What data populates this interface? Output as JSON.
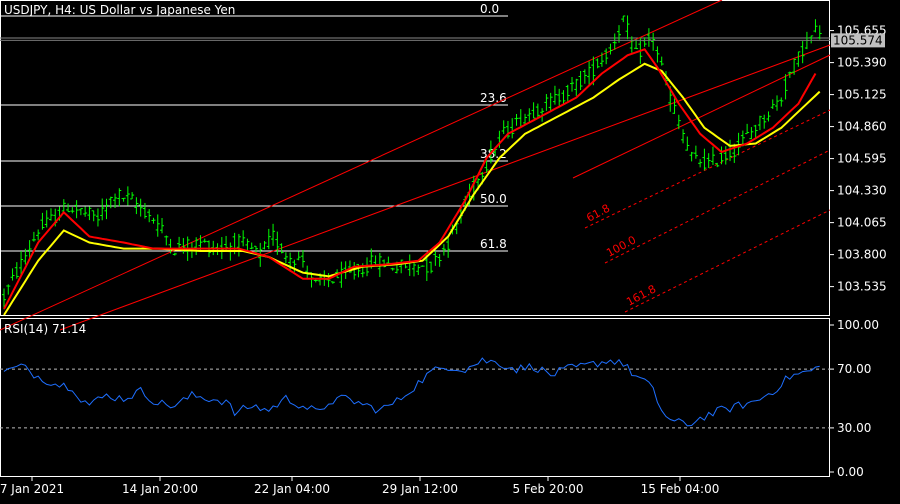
{
  "title": "USDJPY, H4:  US Dollar vs Japanese Yen",
  "colors": {
    "background": "#000000",
    "frame": "#ffffff",
    "bull_candle": "#00ff00",
    "ma_fast": "#ff0000",
    "ma_slow": "#ffff00",
    "fib_line": "#ffffff",
    "channel": "#ff0000",
    "fib_expansion": "#ff0000",
    "rsi_line": "#1e6fff",
    "price_label_bg": "#c0c0c0",
    "price_label_text": "#000000"
  },
  "chart_data": {
    "type": "candlestick",
    "symbol": "USDJPY",
    "timeframe": "H4",
    "price_axis": {
      "min": 103.3,
      "max": 105.9,
      "ticks": [
        "105.655",
        "105.390",
        "105.125",
        "104.860",
        "104.595",
        "104.330",
        "104.065",
        "103.800",
        "103.535"
      ]
    },
    "current_price": "105.574",
    "x_ticks": [
      "7 Jan 2021",
      "14 Jan 20:00",
      "22 Jan 04:00",
      "29 Jan 12:00",
      "5 Feb 20:00",
      "15 Feb 04:00"
    ],
    "close_path": [
      [
        0,
        103.45
      ],
      [
        8,
        104.0
      ],
      [
        15,
        104.2
      ],
      [
        22,
        104.1
      ],
      [
        26,
        104.3
      ],
      [
        30,
        104.25
      ],
      [
        35,
        104.1
      ],
      [
        40,
        103.85
      ],
      [
        46,
        103.9
      ],
      [
        50,
        103.85
      ],
      [
        55,
        103.9
      ],
      [
        60,
        103.8
      ],
      [
        63,
        103.95
      ],
      [
        66,
        103.8
      ],
      [
        70,
        103.75
      ],
      [
        73,
        103.55
      ],
      [
        77,
        103.6
      ],
      [
        82,
        103.65
      ],
      [
        87,
        103.75
      ],
      [
        92,
        103.7
      ],
      [
        97,
        103.72
      ],
      [
        100,
        103.7
      ],
      [
        104,
        103.9
      ],
      [
        108,
        104.2
      ],
      [
        112,
        104.5
      ],
      [
        117,
        104.8
      ],
      [
        122,
        104.95
      ],
      [
        127,
        105.05
      ],
      [
        132,
        105.15
      ],
      [
        137,
        105.3
      ],
      [
        142,
        105.5
      ],
      [
        145,
        105.75
      ],
      [
        148,
        105.45
      ],
      [
        152,
        105.6
      ],
      [
        156,
        105.1
      ],
      [
        159,
        104.8
      ],
      [
        161,
        104.6
      ],
      [
        165,
        104.55
      ],
      [
        169,
        104.62
      ],
      [
        172,
        104.7
      ],
      [
        177,
        104.9
      ],
      [
        182,
        105.1
      ],
      [
        184,
        105.3
      ],
      [
        187,
        105.5
      ],
      [
        190,
        105.65
      ]
    ],
    "ma_fast_path": [
      [
        0,
        103.35
      ],
      [
        8,
        103.9
      ],
      [
        14,
        104.15
      ],
      [
        20,
        103.95
      ],
      [
        28,
        103.9
      ],
      [
        35,
        103.85
      ],
      [
        45,
        103.85
      ],
      [
        55,
        103.85
      ],
      [
        62,
        103.78
      ],
      [
        70,
        103.6
      ],
      [
        76,
        103.6
      ],
      [
        82,
        103.7
      ],
      [
        90,
        103.72
      ],
      [
        97,
        103.75
      ],
      [
        102,
        103.9
      ],
      [
        108,
        104.25
      ],
      [
        113,
        104.6
      ],
      [
        118,
        104.8
      ],
      [
        126,
        104.95
      ],
      [
        134,
        105.1
      ],
      [
        140,
        105.3
      ],
      [
        146,
        105.45
      ],
      [
        150,
        105.5
      ],
      [
        153,
        105.35
      ],
      [
        158,
        105.05
      ],
      [
        163,
        104.8
      ],
      [
        168,
        104.65
      ],
      [
        174,
        104.72
      ],
      [
        180,
        104.85
      ],
      [
        186,
        105.05
      ],
      [
        190,
        105.3
      ]
    ],
    "ma_slow_path": [
      [
        0,
        103.3
      ],
      [
        8,
        103.75
      ],
      [
        14,
        104.0
      ],
      [
        20,
        103.9
      ],
      [
        28,
        103.85
      ],
      [
        36,
        103.85
      ],
      [
        46,
        103.83
      ],
      [
        56,
        103.83
      ],
      [
        62,
        103.78
      ],
      [
        70,
        103.65
      ],
      [
        76,
        103.62
      ],
      [
        84,
        103.7
      ],
      [
        92,
        103.72
      ],
      [
        98,
        103.75
      ],
      [
        104,
        103.95
      ],
      [
        110,
        104.3
      ],
      [
        116,
        104.6
      ],
      [
        122,
        104.8
      ],
      [
        130,
        104.95
      ],
      [
        138,
        105.1
      ],
      [
        144,
        105.25
      ],
      [
        150,
        105.38
      ],
      [
        154,
        105.32
      ],
      [
        159,
        105.1
      ],
      [
        164,
        104.85
      ],
      [
        170,
        104.7
      ],
      [
        176,
        104.72
      ],
      [
        182,
        104.85
      ],
      [
        188,
        105.05
      ],
      [
        191,
        105.15
      ]
    ],
    "rsi": {
      "label": "RSI(14) 71.14",
      "levels": [
        70,
        30
      ],
      "axis_ticks": [
        "100.00",
        "70.00",
        "30.00",
        "0.00"
      ],
      "values": [
        [
          0,
          68
        ],
        [
          4,
          72
        ],
        [
          8,
          65
        ],
        [
          12,
          60
        ],
        [
          16,
          58
        ],
        [
          18,
          50
        ],
        [
          20,
          46
        ],
        [
          24,
          52
        ],
        [
          28,
          50
        ],
        [
          32,
          55
        ],
        [
          36,
          47
        ],
        [
          40,
          45
        ],
        [
          44,
          52
        ],
        [
          48,
          50
        ],
        [
          52,
          48
        ],
        [
          54,
          40
        ],
        [
          58,
          45
        ],
        [
          62,
          42
        ],
        [
          66,
          50
        ],
        [
          70,
          45
        ],
        [
          74,
          40
        ],
        [
          76,
          48
        ],
        [
          80,
          50
        ],
        [
          84,
          46
        ],
        [
          88,
          42
        ],
        [
          92,
          48
        ],
        [
          96,
          58
        ],
        [
          100,
          68
        ],
        [
          104,
          72
        ],
        [
          108,
          70
        ],
        [
          112,
          76
        ],
        [
          116,
          74
        ],
        [
          120,
          70
        ],
        [
          124,
          72
        ],
        [
          128,
          66
        ],
        [
          132,
          70
        ],
        [
          136,
          72
        ],
        [
          140,
          75
        ],
        [
          144,
          76
        ],
        [
          148,
          65
        ],
        [
          150,
          62
        ],
        [
          152,
          55
        ],
        [
          154,
          42
        ],
        [
          156,
          35
        ],
        [
          160,
          32
        ],
        [
          164,
          38
        ],
        [
          168,
          42
        ],
        [
          172,
          45
        ],
        [
          176,
          48
        ],
        [
          180,
          55
        ],
        [
          184,
          65
        ],
        [
          188,
          68
        ],
        [
          191,
          71
        ]
      ]
    },
    "fibonacci_retracement": {
      "levels": [
        "0.0",
        "23.6",
        "38.2",
        "50.0",
        "61.8"
      ]
    },
    "fibonacci_expansion": {
      "levels": [
        "61.8",
        "100.0",
        "161.8"
      ]
    },
    "bars_total": 192,
    "seed": 12345
  }
}
